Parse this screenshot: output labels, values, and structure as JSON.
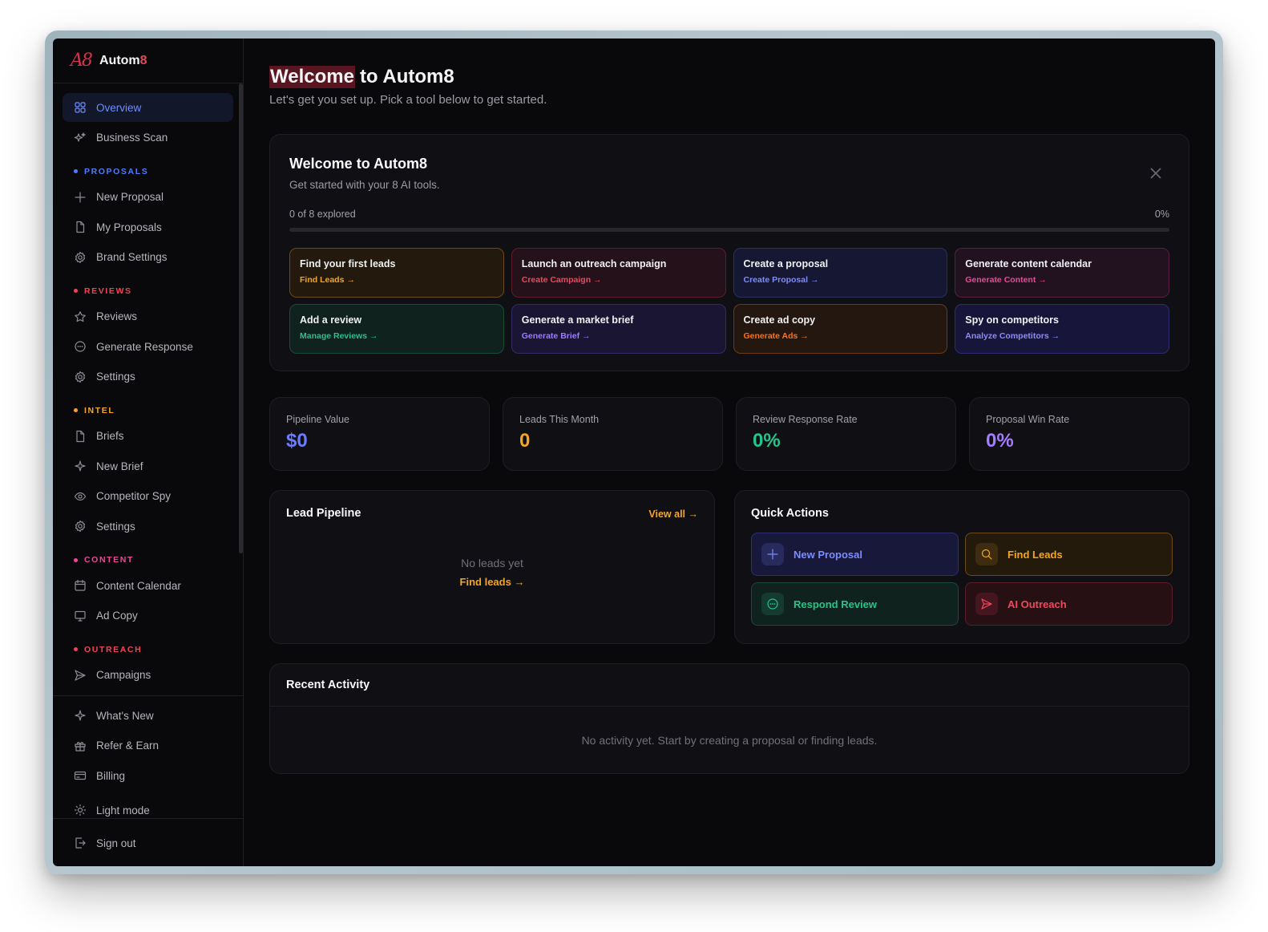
{
  "brand": {
    "logo": "A8",
    "name": "Autom",
    "name_accent": "8"
  },
  "sidebar": {
    "top": [
      {
        "label": "Overview",
        "icon": "grid-icon",
        "active": true
      },
      {
        "label": "Business Scan",
        "icon": "sparkles-icon"
      }
    ],
    "sections": [
      {
        "title": "PROPOSALS",
        "color": "#4f7bff",
        "items": [
          {
            "label": "New Proposal",
            "icon": "plus-icon"
          },
          {
            "label": "My Proposals",
            "icon": "file-icon"
          },
          {
            "label": "Brand Settings",
            "icon": "gear-icon"
          }
        ]
      },
      {
        "title": "REVIEWS",
        "color": "#ef4458",
        "items": [
          {
            "label": "Reviews",
            "icon": "star-icon"
          },
          {
            "label": "Generate Response",
            "icon": "chat-icon"
          },
          {
            "label": "Settings",
            "icon": "gear-icon"
          }
        ]
      },
      {
        "title": "INTEL",
        "color": "#f5a524",
        "items": [
          {
            "label": "Briefs",
            "icon": "file-icon"
          },
          {
            "label": "New Brief",
            "icon": "sparkle-icon"
          },
          {
            "label": "Competitor Spy",
            "icon": "eye-icon"
          },
          {
            "label": "Settings",
            "icon": "gear-icon"
          }
        ]
      },
      {
        "title": "CONTENT",
        "color": "#ec4899",
        "items": [
          {
            "label": "Content Calendar",
            "icon": "calendar-icon"
          },
          {
            "label": "Ad Copy",
            "icon": "monitor-icon"
          }
        ]
      },
      {
        "title": "OUTREACH",
        "color": "#ef4458",
        "items": [
          {
            "label": "Campaigns",
            "icon": "send-icon"
          }
        ]
      }
    ],
    "bottom": [
      {
        "label": "What's New",
        "icon": "sparkle-icon"
      },
      {
        "label": "Refer & Earn",
        "icon": "gift-icon"
      },
      {
        "label": "Billing",
        "icon": "card-icon"
      },
      {
        "label": "Light mode",
        "icon": "sun-icon"
      }
    ],
    "signout": {
      "label": "Sign out",
      "icon": "logout-icon"
    }
  },
  "header": {
    "title_highlight": "Welcome",
    "title_rest": "to Autom8",
    "subtitle": "Let's get you set up. Pick a tool below to get started."
  },
  "welcome": {
    "title": "Welcome to Autom8",
    "subtitle": "Get started with your 8 AI tools.",
    "progress_label": "0 of 8 explored",
    "progress_percent": "0%",
    "progress_fraction": 0,
    "tiles": [
      {
        "title": "Find your first leads",
        "link": "Find Leads →",
        "color": "#f5a524",
        "bg": "#231a0d",
        "border": "#6b4a14"
      },
      {
        "title": "Launch an outreach campaign",
        "link": "Create Campaign →",
        "color": "#f0475c",
        "bg": "#24111a",
        "border": "#5e1d2a"
      },
      {
        "title": "Create a proposal",
        "link": "Create Proposal →",
        "color": "#7c8cff",
        "bg": "#161733",
        "border": "#2b2f66"
      },
      {
        "title": "Generate content calendar",
        "link": "Generate Content →",
        "color": "#ec4899",
        "bg": "#22111f",
        "border": "#5a1f45"
      },
      {
        "title": "Add a review",
        "link": "Manage Reviews →",
        "color": "#22c58b",
        "bg": "#0f221d",
        "border": "#1a4a3a"
      },
      {
        "title": "Generate a market brief",
        "link": "Generate Brief →",
        "color": "#9b7bff",
        "bg": "#1a1533",
        "border": "#342a66"
      },
      {
        "title": "Create ad copy",
        "link": "Generate Ads →",
        "color": "#f97316",
        "bg": "#24170f",
        "border": "#6a3b15"
      },
      {
        "title": "Spy on competitors",
        "link": "Analyze Competitors →",
        "color": "#8b8bff",
        "bg": "#17163a",
        "border": "#2f2d6e"
      }
    ]
  },
  "stats": [
    {
      "label": "Pipeline Value",
      "value": "$0",
      "color": "#6d7bff"
    },
    {
      "label": "Leads This Month",
      "value": "0",
      "color": "#f5a524"
    },
    {
      "label": "Review Response Rate",
      "value": "0%",
      "color": "#22c58b"
    },
    {
      "label": "Proposal Win Rate",
      "value": "0%",
      "color": "#a57bff"
    }
  ],
  "pipeline": {
    "title": "Lead Pipeline",
    "view_all": "View all →",
    "empty": "No leads yet",
    "empty_link": "Find leads →"
  },
  "quick": {
    "title": "Quick Actions",
    "actions": [
      {
        "label": "New Proposal",
        "icon": "plus-icon",
        "color": "#7c8cff",
        "bg": "#17183a",
        "border": "#2d3070",
        "icbg": "#272a5c"
      },
      {
        "label": "Find Leads",
        "icon": "search-icon",
        "color": "#f5a524",
        "bg": "#241a0c",
        "border": "#6b4a14",
        "icbg": "#3d2c10"
      },
      {
        "label": "Respond Review",
        "icon": "chat-icon",
        "color": "#22c58b",
        "bg": "#0f221d",
        "border": "#1a4a3a",
        "icbg": "#153a2f"
      },
      {
        "label": "AI Outreach",
        "icon": "send-icon",
        "color": "#f0475c",
        "bg": "#261014",
        "border": "#5e1d2a",
        "icbg": "#45161f"
      }
    ]
  },
  "recent": {
    "title": "Recent Activity",
    "empty": "No activity yet. Start by creating a proposal or finding leads."
  }
}
